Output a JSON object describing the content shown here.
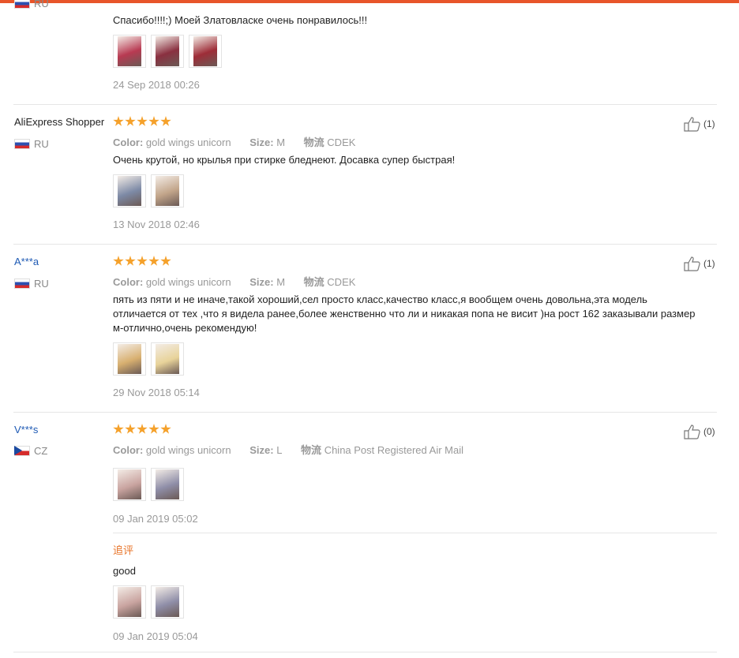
{
  "partial_top": {
    "country": "RU",
    "text": "Спасибо!!!!;) Моей Златовласке очень понравилось!!!",
    "photo_colors": [
      "#b83a52",
      "#8a3040",
      "#9e2d38"
    ],
    "date": "24 Sep 2018 00:26"
  },
  "labels": {
    "color": "Color:",
    "size": "Size:",
    "logistics": "物流"
  },
  "reviews": [
    {
      "user": "AliExpress Shopper",
      "country": "RU",
      "flag": "ru",
      "stars": 5,
      "color": "gold wings unicorn",
      "size": "M",
      "shipping": "CDEK",
      "text": "Очень крутой, но крылья при стирке бледнеют. Досавка супер быстрая!",
      "photo_colors": [
        "#7d8aa6",
        "#c2a58a"
      ],
      "date": "13 Nov 2018 02:46",
      "helpful": "(1)"
    },
    {
      "user": "A***a",
      "country": "RU",
      "flag": "ru",
      "stars": 5,
      "color": "gold wings unicorn",
      "size": "M",
      "shipping": "CDEK",
      "text": "пять из пяти и не иначе,такой хороший,сел просто класс,качество класс,я вообщем очень довольна,эта модель отличается от тех ,что я видела ранее,более женственно что ли и никакая попа не висит )на рост 162 заказывали размер м-отлично,очень рекомендую!",
      "photo_colors": [
        "#d8b070",
        "#e8d39a"
      ],
      "date": "29 Nov 2018 05:14",
      "helpful": "(1)"
    },
    {
      "user": "V***s",
      "country": "CZ",
      "flag": "cz",
      "stars": 5,
      "color": "gold wings unicorn",
      "size": "L",
      "shipping": "China Post Registered Air Mail",
      "text": "",
      "photo_colors": [
        "#c9a4a0",
        "#8f8ea8"
      ],
      "date": "09 Jan 2019 05:02",
      "helpful": "(0)",
      "additional_label": "追评",
      "additional_text": "good",
      "additional_photo_colors": [
        "#c9a4a0",
        "#8f8ea8"
      ],
      "additional_date": "09 Jan 2019 05:04"
    }
  ]
}
